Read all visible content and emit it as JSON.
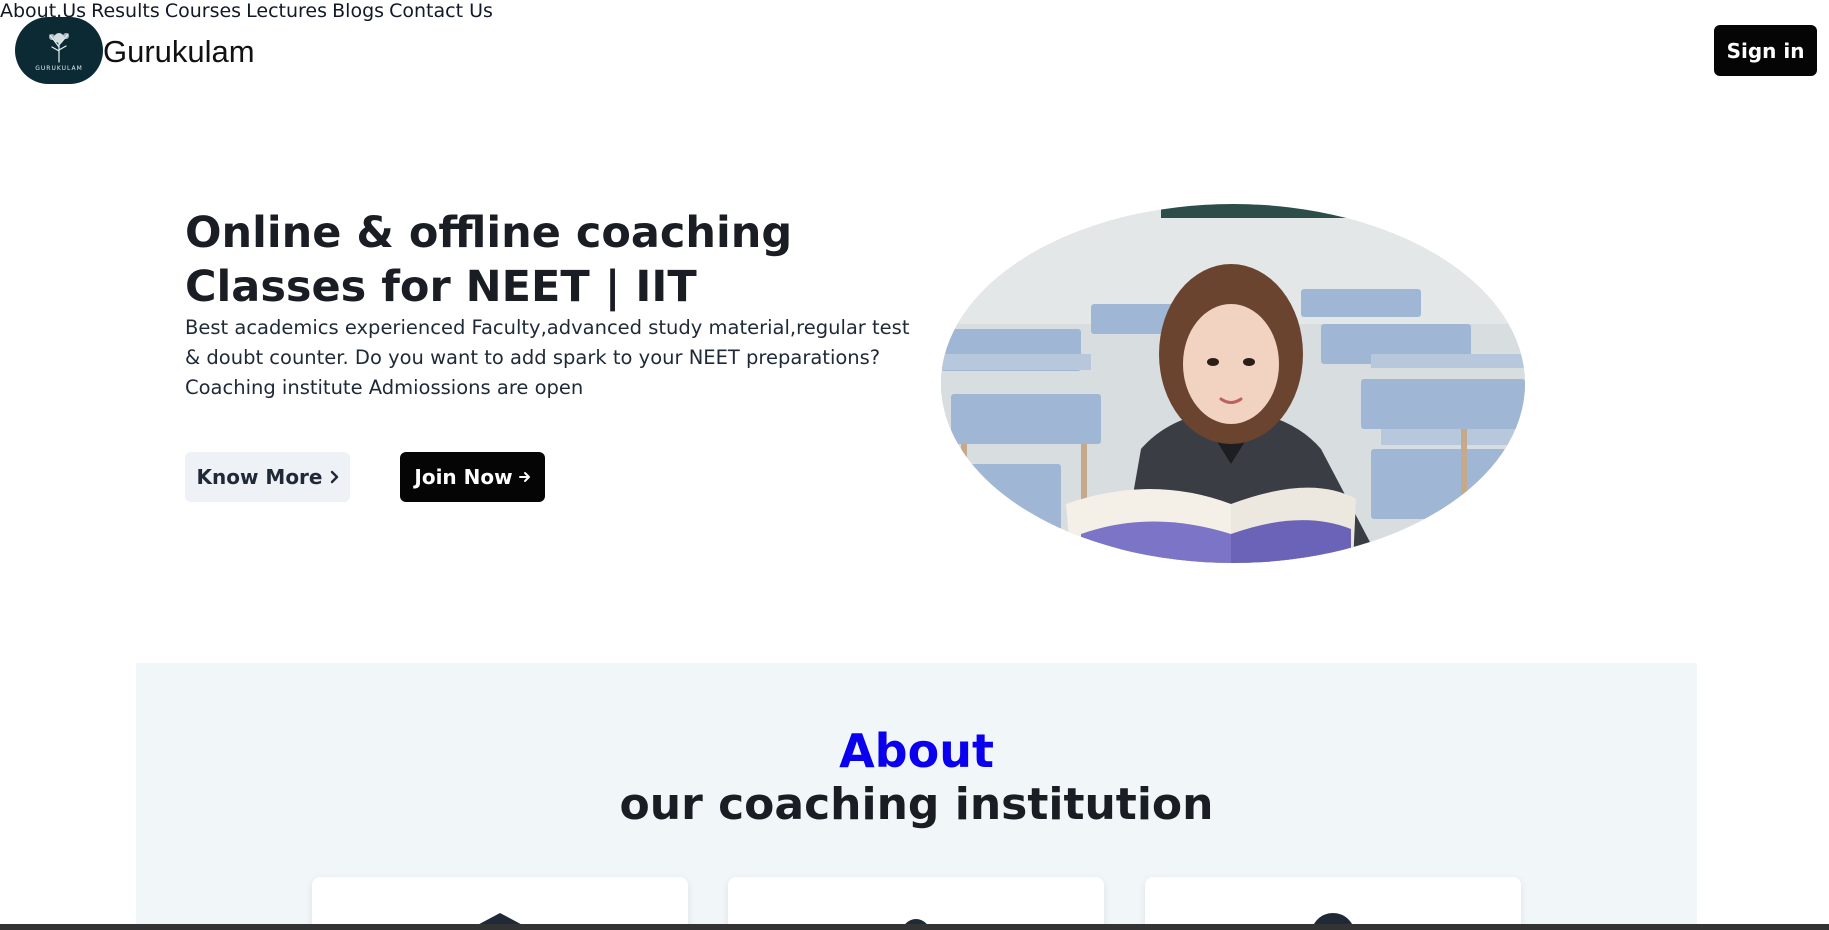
{
  "header": {
    "logo_text": "GURUKULAM",
    "brand": "Gurukulam",
    "nav": [
      "About.Us",
      "Results",
      "Courses",
      "Lectures",
      "Blogs",
      "Contact Us"
    ],
    "signin_label": "Sign in"
  },
  "hero": {
    "title_line1": "Online & offline coaching",
    "title_line2": "Classes for NEET | IIT",
    "description": "Best academics experienced Faculty,advanced study material,regular test & doubt counter. Do you want to add spark to your NEET preparations? Coaching institute Admiossions are open",
    "know_more_label": "Know More",
    "join_now_label": "Join Now",
    "know_more_icon": "chevron-right-icon",
    "join_now_icon": "arrow-right-icon"
  },
  "about": {
    "kicker": "About",
    "heading": "our coaching institution",
    "cards": [
      {
        "icon": "graduation-cap-icon"
      },
      {
        "icon": "user-icon"
      },
      {
        "icon": "circle-icon"
      }
    ]
  },
  "colors": {
    "accent_blue": "#0a00ee",
    "dark": "#050505",
    "logo_bg": "#0b2a33",
    "section_bg": "#f1f6f9"
  }
}
